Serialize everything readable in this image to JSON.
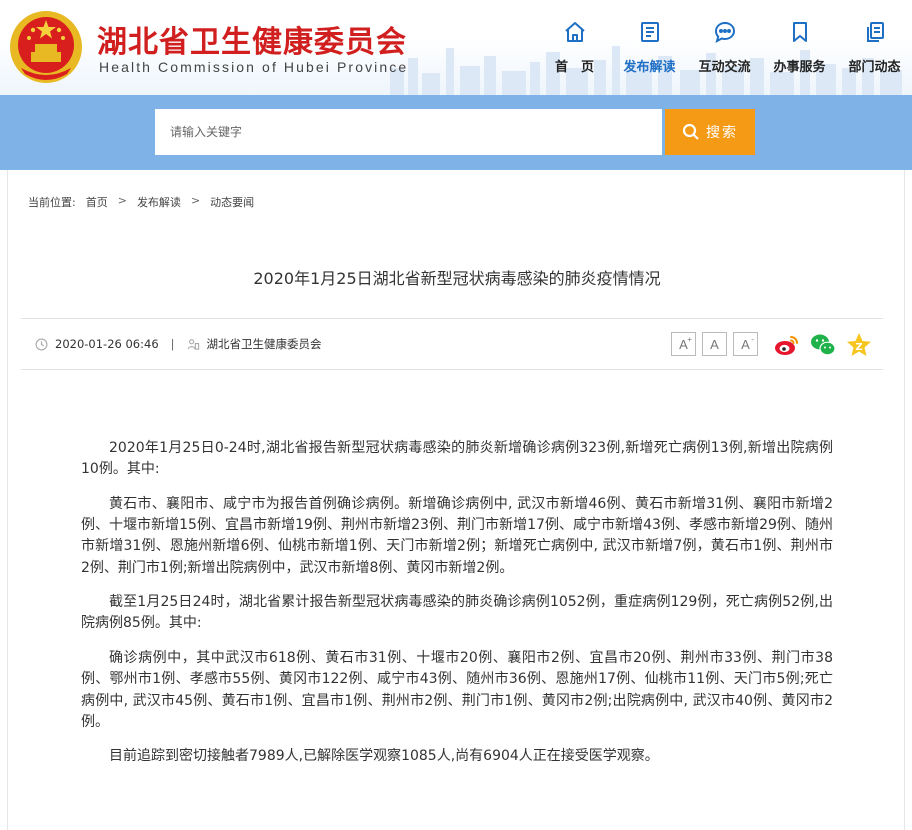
{
  "header": {
    "site_title": "湖北省卫生健康委员会",
    "site_subtitle": "Health Commission of Hubei Province",
    "emblem_icon": "national-emblem-icon"
  },
  "nav": {
    "items": [
      {
        "label": "首　页",
        "icon": "home-icon"
      },
      {
        "label": "发布解读",
        "icon": "document-icon",
        "active": true
      },
      {
        "label": "互动交流",
        "icon": "chat-icon"
      },
      {
        "label": "办事服务",
        "icon": "bookmark-icon"
      },
      {
        "label": "部门动态",
        "icon": "copy-icon"
      }
    ],
    "active_color": "#1f6fc5"
  },
  "search": {
    "placeholder": "请输入关键字",
    "button_label": "搜索",
    "band_color": "#7fb2e6",
    "button_color": "#f59a14"
  },
  "breadcrumb": {
    "prefix": "当前位置:",
    "items": [
      "首页",
      "发布解读",
      "动态要闻"
    ],
    "separator": ">"
  },
  "article": {
    "title": "2020年1月25日湖北省新型冠状病毒感染的肺炎疫情情况",
    "date": "2020-01-26 06:46",
    "source": "湖北省卫生健康委员会",
    "font_size_buttons": [
      "A",
      "A",
      "A"
    ],
    "font_size_marks": [
      "+",
      "",
      "-"
    ],
    "share_icons": [
      "weibo-icon",
      "wechat-icon",
      "favorite-star-icon"
    ],
    "paragraphs": [
      "2020年1月25日0-24时,湖北省报告新型冠状病毒感染的肺炎新增确诊病例323例,新增死亡病例13例,新增出院病例10例。其中:",
      "黄石市、襄阳市、咸宁市为报告首例确诊病例。新增确诊病例中, 武汉市新增46例、黄石市新增31例、襄阳市新增2例、十堰市新增15例、宜昌市新增19例、荆州市新增23例、荆门市新增17例、咸宁市新增43例、孝感市新增29例、随州市新增31例、恩施州新增6例、仙桃市新增1例、天门市新增2例；新增死亡病例中, 武汉市新增7例，黄石市1例、荆州市2例、荆门市1例;新增出院病例中，武汉市新增8例、黄冈市新增2例。",
      "截至1月25日24时，湖北省累计报告新型冠状病毒感染的肺炎确诊病例1052例，重症病例129例，死亡病例52例,出院病例85例。其中:",
      "确诊病例中，其中武汉市618例、黄石市31例、十堰市20例、襄阳市2例、宜昌市20例、荆州市33例、荆门市38例、鄂州市1例、孝感市55例、黄冈市122例、咸宁市43例、随州市36例、恩施州17例、仙桃市11例、天门市5例;死亡病例中, 武汉市45例、黄石市1例、宜昌市1例、荆州市2例、荆门市1例、黄冈市2例;出院病例中, 武汉市40例、黄冈市2例。",
      "目前追踪到密切接触者7989人,已解除医学观察1085人,尚有6904人正在接受医学观察。"
    ]
  }
}
